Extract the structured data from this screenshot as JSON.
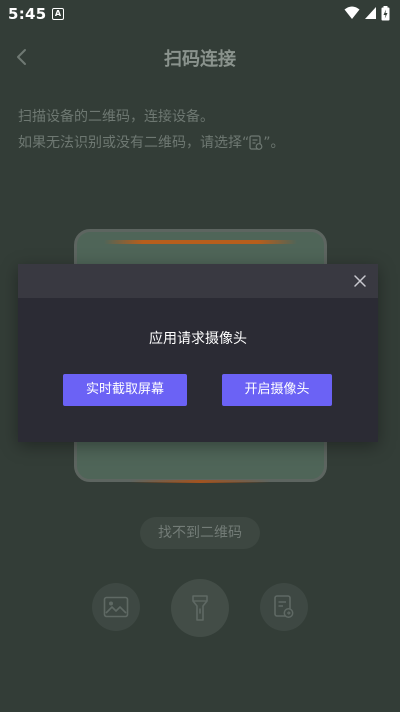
{
  "status_bar": {
    "time": "5:45",
    "notification_icon": "A"
  },
  "nav": {
    "title": "扫码连接",
    "back_icon": "chevron-left-icon"
  },
  "instructions": {
    "line1": "扫描设备的二维码，连接设备。",
    "line2_prefix": "如果无法识别或没有二维码，请选择“",
    "line2_suffix": "”。"
  },
  "scan": {
    "not_found_label": "找不到二维码"
  },
  "tools": {
    "album_icon": "image-icon",
    "flash_icon": "flashlight-icon",
    "manual_icon": "manual-entry-icon"
  },
  "dialog": {
    "message": "应用请求摄像头",
    "capture_button": "实时截取屏幕",
    "camera_button": "开启摄像头",
    "close_icon": "close-icon"
  },
  "colors": {
    "background": "#333d37",
    "accent": "#6b62f5",
    "dialog_bg": "#2b2b34",
    "dialog_header": "#393941",
    "scan_fill": "#4f6558"
  }
}
